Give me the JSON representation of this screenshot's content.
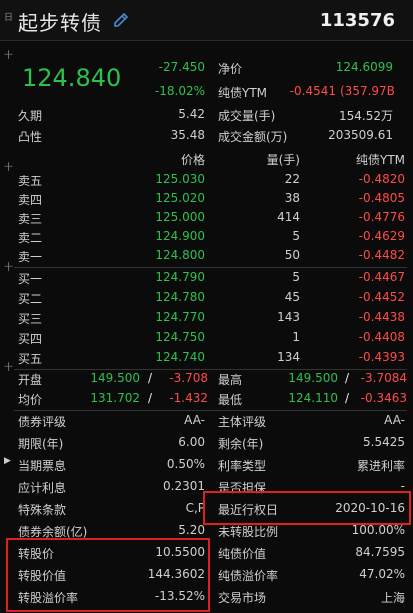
{
  "header": {
    "title": "起步转债",
    "code": "113576",
    "side_marks": [
      "日",
      "十",
      "十",
      "十",
      "十"
    ]
  },
  "quote": {
    "price": "124.840",
    "change": "-27.450",
    "change_pct": "-18.02%",
    "net_price_label": "净价",
    "net_price": "124.6099",
    "ytm_label": "纯债YTM",
    "ytm": "-0.4541",
    "ytm_extra": "(357.97B",
    "duration_label": "久期",
    "duration": "5.42",
    "convexity_label": "凸性",
    "convexity": "35.48",
    "volume_label": "成交量(手)",
    "volume": "154.52万",
    "amount_label": "成交金额(万)",
    "amount": "203509.61"
  },
  "book": {
    "headers": [
      "价格",
      "量(手)",
      "纯债YTM"
    ],
    "asks": [
      {
        "label": "卖五",
        "price": "125.030",
        "qty": "22",
        "ytm": "-0.4820"
      },
      {
        "label": "卖四",
        "price": "125.020",
        "qty": "38",
        "ytm": "-0.4805"
      },
      {
        "label": "卖三",
        "price": "125.000",
        "qty": "414",
        "ytm": "-0.4776"
      },
      {
        "label": "卖二",
        "price": "124.900",
        "qty": "5",
        "ytm": "-0.4629"
      },
      {
        "label": "卖一",
        "price": "124.800",
        "qty": "50",
        "ytm": "-0.4482"
      }
    ],
    "bids": [
      {
        "label": "买一",
        "price": "124.790",
        "qty": "5",
        "ytm": "-0.4467"
      },
      {
        "label": "买二",
        "price": "124.780",
        "qty": "45",
        "ytm": "-0.4452"
      },
      {
        "label": "买三",
        "price": "124.770",
        "qty": "143",
        "ytm": "-0.4438"
      },
      {
        "label": "买四",
        "price": "124.750",
        "qty": "1",
        "ytm": "-0.4408"
      },
      {
        "label": "买五",
        "price": "124.740",
        "qty": "134",
        "ytm": "-0.4393"
      }
    ]
  },
  "summary": {
    "open_label": "开盘",
    "open": "149.500",
    "open_slash": "/",
    "open_ytm": "-3.708",
    "high_label": "最高",
    "high": "149.500",
    "high_slash": "/",
    "high_ytm": "-3.7084",
    "avg_label": "均价",
    "avg": "131.702",
    "avg_slash": "/",
    "avg_ytm": "-1.432",
    "low_label": "最低",
    "low": "124.110",
    "low_slash": "/",
    "low_ytm": "-0.3463"
  },
  "info": {
    "left": [
      {
        "label": "债券评级",
        "value": "AA-"
      },
      {
        "label": "期限(年)",
        "value": "6.00"
      },
      {
        "label": "当期票息",
        "value": "0.50%"
      },
      {
        "label": "应计利息",
        "value": "0.2301"
      },
      {
        "label": "特殊条款",
        "value": "C,P"
      },
      {
        "label": "债券余额(亿)",
        "value": "5.20"
      },
      {
        "label": "转股价",
        "value": "10.5500"
      },
      {
        "label": "转股价值",
        "value": "144.3602"
      },
      {
        "label": "转股溢价率",
        "value": "-13.52%"
      }
    ],
    "right": [
      {
        "label": "主体评级",
        "value": "AA-"
      },
      {
        "label": "剩余(年)",
        "value": "5.5425"
      },
      {
        "label": "利率类型",
        "value": "累进利率"
      },
      {
        "label": "是否担保",
        "value": "-"
      },
      {
        "label": "最近行权日",
        "value": "2020-10-16"
      },
      {
        "label": "未转股比例",
        "value": "100.00%"
      },
      {
        "label": "纯债价值",
        "value": "84.7595"
      },
      {
        "label": "纯债溢价率",
        "value": "47.02%"
      },
      {
        "label": "交易市场",
        "value": "上海"
      }
    ]
  }
}
